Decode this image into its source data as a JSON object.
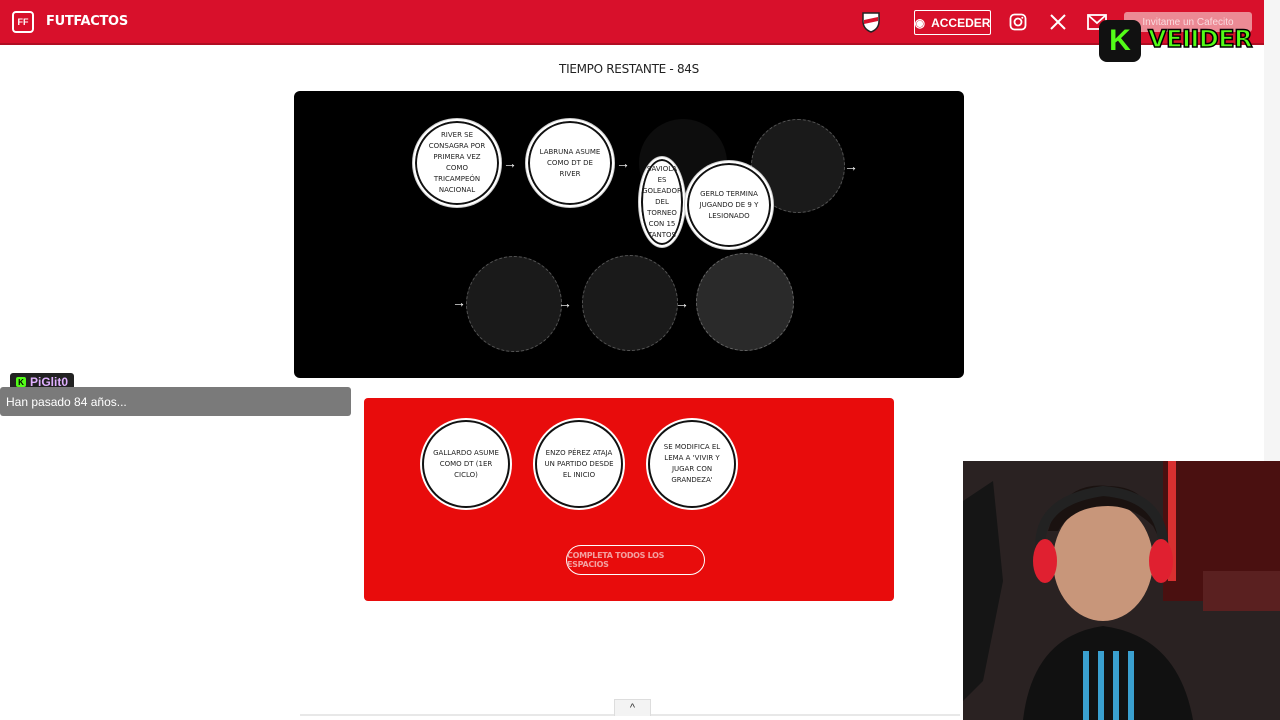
{
  "header": {
    "brand": "FUTFACTOS",
    "logo_text": "FF",
    "login_label": "ACCEDER",
    "cafecito_label": "Invitame un Cafecito",
    "colors": {
      "bar": "#d8102b"
    }
  },
  "overlay": {
    "kick_letter": "K",
    "kick_name": "VEIIDER",
    "chat_user": "PiGlit0",
    "chat_badge": "K",
    "chat_message": "Han pasado 84 años..."
  },
  "timer": "TIEMPO RESTANTE - 84S",
  "board": {
    "placed": [
      "RIVER SE CONSAGRA POR PRIMERA VEZ COMO TRICAMPEÓN NACIONAL",
      "LABRUNA ASUME COMO DT DE RIVER",
      "SAVIOLA ES GOLEADOR DEL TORNEO CON 15 TANTOS",
      "GERLO TERMINA JUGANDO DE 9 Y LESIONADO"
    ],
    "arrow": "→"
  },
  "bank": {
    "options": [
      "GALLARDO ASUME COMO DT (1ER CICLO)",
      "ENZO PÉREZ ATAJA UN PARTIDO DESDE EL INICIO",
      "SE MODIFICA EL LEMA A 'VIVIR Y JUGAR CON GRANDEZA'"
    ],
    "complete_label": "COMPLETA TODOS LOS ESPACIOS"
  },
  "footer": {
    "scroll_up": "^"
  }
}
